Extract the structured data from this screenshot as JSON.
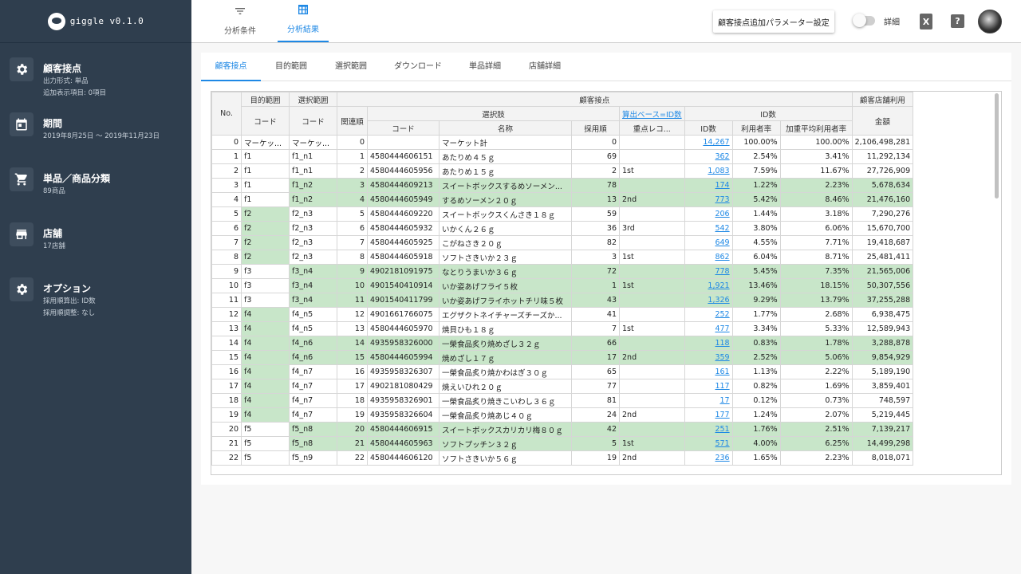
{
  "app": {
    "name": "giggle v0.1.0"
  },
  "sidebar": {
    "items": [
      {
        "title": "顧客接点",
        "icon": "gear-icon",
        "lines": [
          "出力形式: 単品",
          "追加表示項目: 0項目"
        ]
      },
      {
        "title": "期間",
        "icon": "calendar-icon",
        "lines": [
          "2019年8月25日 〜 2019年11月23日"
        ]
      },
      {
        "title": "単品／商品分類",
        "icon": "cart-icon",
        "lines": [
          "89商品"
        ]
      },
      {
        "title": "店舗",
        "icon": "store-icon",
        "lines": [
          "17店舗"
        ]
      },
      {
        "title": "オプション",
        "icon": "gear-icon",
        "lines": [
          "採用順算出: ID数",
          "採用順調整: なし"
        ]
      }
    ]
  },
  "topbar": {
    "tabs": [
      {
        "label": "分析条件",
        "icon": "filter-icon"
      },
      {
        "label": "分析結果",
        "icon": "table-icon"
      }
    ],
    "param_button": "顧客接点追加パラメーター設定",
    "toggle_label": "詳細",
    "excel_icon": "X",
    "help_icon": "?"
  },
  "subtabs": [
    "顧客接点",
    "目的範囲",
    "選択範囲",
    "ダウンロード",
    "単品詳細",
    "店舗詳細"
  ],
  "table": {
    "headers": {
      "no": "No.",
      "purpose": "目的範囲",
      "selection": "選択範囲",
      "contact": "顧客接点",
      "store_use": "顧客店舗利用",
      "code": "コード",
      "related_order": "関連順",
      "choice": "選択肢",
      "basis_link": "算出ベース=ID数",
      "id_group": "ID数",
      "name": "名称",
      "adopt_order": "採用順",
      "priority": "重点レコ...",
      "id_count": "ID数",
      "usage_rate": "利用者率",
      "weighted_rate": "加重平均利用者率",
      "amount": "金額"
    },
    "rows": [
      {
        "no": "0",
        "p": "マーケッ...",
        "s": "マーケッ...",
        "rel": "0",
        "code": "",
        "name": "マーケット計",
        "adopt": "0",
        "pri": "",
        "ids": "14,267",
        "rate": "100.00%",
        "wrate": "100.00%",
        "amt": "2,106,498,281",
        "pg": false,
        "sg": false,
        "rg": false
      },
      {
        "no": "1",
        "p": "f1",
        "s": "f1_n1",
        "rel": "1",
        "code": "4580444606151",
        "name": "あたりめ４５ｇ",
        "adopt": "69",
        "pri": "",
        "ids": "362",
        "rate": "2.54%",
        "wrate": "3.41%",
        "amt": "11,292,134",
        "pg": false,
        "sg": false,
        "rg": false
      },
      {
        "no": "2",
        "p": "f1",
        "s": "f1_n1",
        "rel": "2",
        "code": "4580444605956",
        "name": "あたりめ１５ｇ",
        "adopt": "2",
        "pri": "1st",
        "ids": "1,083",
        "rate": "7.59%",
        "wrate": "11.67%",
        "amt": "27,726,909",
        "pg": false,
        "sg": false,
        "rg": false
      },
      {
        "no": "3",
        "p": "f1",
        "s": "f1_n2",
        "rel": "3",
        "code": "4580444609213",
        "name": "スイートボックスするめソーメン...",
        "adopt": "78",
        "pri": "",
        "ids": "174",
        "rate": "1.22%",
        "wrate": "2.23%",
        "amt": "5,678,634",
        "pg": false,
        "sg": true,
        "rg": true
      },
      {
        "no": "4",
        "p": "f1",
        "s": "f1_n2",
        "rel": "4",
        "code": "4580444605949",
        "name": "するめソーメン２０ｇ",
        "adopt": "13",
        "pri": "2nd",
        "ids": "773",
        "rate": "5.42%",
        "wrate": "8.46%",
        "amt": "21,476,160",
        "pg": false,
        "sg": true,
        "rg": true
      },
      {
        "no": "5",
        "p": "f2",
        "s": "f2_n3",
        "rel": "5",
        "code": "4580444609220",
        "name": "スイートボックスくんさき１８ｇ",
        "adopt": "59",
        "pri": "",
        "ids": "206",
        "rate": "1.44%",
        "wrate": "3.18%",
        "amt": "7,290,276",
        "pg": true,
        "sg": false,
        "rg": false
      },
      {
        "no": "6",
        "p": "f2",
        "s": "f2_n3",
        "rel": "6",
        "code": "4580444605932",
        "name": "いかくん２６ｇ",
        "adopt": "36",
        "pri": "3rd",
        "ids": "542",
        "rate": "3.80%",
        "wrate": "6.06%",
        "amt": "15,670,700",
        "pg": true,
        "sg": false,
        "rg": false
      },
      {
        "no": "7",
        "p": "f2",
        "s": "f2_n3",
        "rel": "7",
        "code": "4580444605925",
        "name": "こがねさき２０ｇ",
        "adopt": "82",
        "pri": "",
        "ids": "649",
        "rate": "4.55%",
        "wrate": "7.71%",
        "amt": "19,418,687",
        "pg": true,
        "sg": false,
        "rg": false
      },
      {
        "no": "8",
        "p": "f2",
        "s": "f2_n3",
        "rel": "8",
        "code": "4580444605918",
        "name": "ソフトさきいか２３ｇ",
        "adopt": "3",
        "pri": "1st",
        "ids": "862",
        "rate": "6.04%",
        "wrate": "8.71%",
        "amt": "25,481,411",
        "pg": true,
        "sg": false,
        "rg": false
      },
      {
        "no": "9",
        "p": "f3",
        "s": "f3_n4",
        "rel": "9",
        "code": "4902181091975",
        "name": "なとりうまいか３６ｇ",
        "adopt": "72",
        "pri": "",
        "ids": "778",
        "rate": "5.45%",
        "wrate": "7.35%",
        "amt": "21,565,006",
        "pg": false,
        "sg": true,
        "rg": true
      },
      {
        "no": "10",
        "p": "f3",
        "s": "f3_n4",
        "rel": "10",
        "code": "4901540410914",
        "name": "いか姿あげフライ５枚",
        "adopt": "1",
        "pri": "1st",
        "ids": "1,921",
        "rate": "13.46%",
        "wrate": "18.15%",
        "amt": "50,307,556",
        "pg": false,
        "sg": true,
        "rg": true
      },
      {
        "no": "11",
        "p": "f3",
        "s": "f3_n4",
        "rel": "11",
        "code": "4901540411799",
        "name": "いか姿あげフライホットチリ味５枚",
        "adopt": "43",
        "pri": "",
        "ids": "1,326",
        "rate": "9.29%",
        "wrate": "13.79%",
        "amt": "37,255,288",
        "pg": false,
        "sg": true,
        "rg": true
      },
      {
        "no": "12",
        "p": "f4",
        "s": "f4_n5",
        "rel": "12",
        "code": "4901661766075",
        "name": "エグザクトネイチャーズチーズか...",
        "adopt": "41",
        "pri": "",
        "ids": "252",
        "rate": "1.77%",
        "wrate": "2.68%",
        "amt": "6,938,475",
        "pg": true,
        "sg": false,
        "rg": false
      },
      {
        "no": "13",
        "p": "f4",
        "s": "f4_n5",
        "rel": "13",
        "code": "4580444605970",
        "name": "焼貝ひも１８ｇ",
        "adopt": "7",
        "pri": "1st",
        "ids": "477",
        "rate": "3.34%",
        "wrate": "5.33%",
        "amt": "12,589,943",
        "pg": true,
        "sg": false,
        "rg": false
      },
      {
        "no": "14",
        "p": "f4",
        "s": "f4_n6",
        "rel": "14",
        "code": "4935958326000",
        "name": "一榮食品炙り焼めざし３２ｇ",
        "adopt": "66",
        "pri": "",
        "ids": "118",
        "rate": "0.83%",
        "wrate": "1.78%",
        "amt": "3,288,878",
        "pg": true,
        "sg": true,
        "rg": true
      },
      {
        "no": "15",
        "p": "f4",
        "s": "f4_n6",
        "rel": "15",
        "code": "4580444605994",
        "name": "焼めざし１７ｇ",
        "adopt": "17",
        "pri": "2nd",
        "ids": "359",
        "rate": "2.52%",
        "wrate": "5.06%",
        "amt": "9,854,929",
        "pg": true,
        "sg": true,
        "rg": true
      },
      {
        "no": "16",
        "p": "f4",
        "s": "f4_n7",
        "rel": "16",
        "code": "4935958326307",
        "name": "一榮食品炙り焼かわはぎ３０ｇ",
        "adopt": "65",
        "pri": "",
        "ids": "161",
        "rate": "1.13%",
        "wrate": "2.22%",
        "amt": "5,189,190",
        "pg": true,
        "sg": false,
        "rg": false
      },
      {
        "no": "17",
        "p": "f4",
        "s": "f4_n7",
        "rel": "17",
        "code": "4902181080429",
        "name": "焼えいひれ２０ｇ",
        "adopt": "77",
        "pri": "",
        "ids": "117",
        "rate": "0.82%",
        "wrate": "1.69%",
        "amt": "3,859,401",
        "pg": true,
        "sg": false,
        "rg": false
      },
      {
        "no": "18",
        "p": "f4",
        "s": "f4_n7",
        "rel": "18",
        "code": "4935958326901",
        "name": "一榮食品炙り焼きこいわし３６ｇ",
        "adopt": "81",
        "pri": "",
        "ids": "17",
        "rate": "0.12%",
        "wrate": "0.73%",
        "amt": "748,597",
        "pg": true,
        "sg": false,
        "rg": false
      },
      {
        "no": "19",
        "p": "f4",
        "s": "f4_n7",
        "rel": "19",
        "code": "4935958326604",
        "name": "一榮食品炙り焼あじ４０ｇ",
        "adopt": "24",
        "pri": "2nd",
        "ids": "177",
        "rate": "1.24%",
        "wrate": "2.07%",
        "amt": "5,219,445",
        "pg": true,
        "sg": false,
        "rg": false
      },
      {
        "no": "20",
        "p": "f5",
        "s": "f5_n8",
        "rel": "20",
        "code": "4580444606915",
        "name": "スイートボックスカリカリ梅８０ｇ",
        "adopt": "42",
        "pri": "",
        "ids": "251",
        "rate": "1.76%",
        "wrate": "2.51%",
        "amt": "7,139,217",
        "pg": false,
        "sg": true,
        "rg": true
      },
      {
        "no": "21",
        "p": "f5",
        "s": "f5_n8",
        "rel": "21",
        "code": "4580444605963",
        "name": "ソフトプッチン３２ｇ",
        "adopt": "5",
        "pri": "1st",
        "ids": "571",
        "rate": "4.00%",
        "wrate": "6.25%",
        "amt": "14,499,298",
        "pg": false,
        "sg": true,
        "rg": true
      },
      {
        "no": "22",
        "p": "f5",
        "s": "f5_n9",
        "rel": "22",
        "code": "4580444606120",
        "name": "ソフトさきいか５６ｇ",
        "adopt": "19",
        "pri": "2nd",
        "ids": "236",
        "rate": "1.65%",
        "wrate": "2.23%",
        "amt": "8,018,071",
        "pg": false,
        "sg": false,
        "rg": false
      }
    ]
  }
}
